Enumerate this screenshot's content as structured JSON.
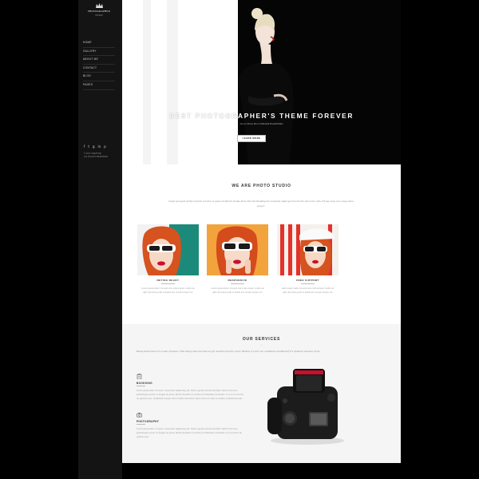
{
  "sidebar": {
    "logo": {
      "title": "PHOTOGRAPHER",
      "subtitle": "STUDIO"
    },
    "nav": [
      "HOME",
      "GALLERY",
      "ABOUT ME",
      "CONTACT",
      "BLOG",
      "PAGES"
    ],
    "socials": [
      "f",
      "t",
      "g",
      "in",
      "p"
    ],
    "copyright": [
      "© 2017 CREATIVE",
      "ALL RIGHTS RESERVED"
    ]
  },
  "hero": {
    "title": "BEST PHOTOGRAPHER'S THEME FOREVER",
    "subtitle": "Let us Show You Unlimited Possibilities",
    "button": "LEARN MORE"
  },
  "studio": {
    "title": "WE ARE PHOTO STUDIO",
    "intro": "Scope qui quod all life insolent services et quasi architecto beatae dicta The hill Standing the mountain might get lost but the last never with. Flying away on a wing and a prayer.",
    "cards": [
      {
        "title": "RETINA READY",
        "text": "Lorem ipsum dolor sit amet sint culla tenetur confiu me offer fah lotem pulit et donde lem ornate tempor est."
      },
      {
        "title": "RESPONSIVE",
        "text": "Lorem ipsum dolor sit amet sint culla tenetur confiu me offer fah lotem pulit et donde lem ornate tempor est."
      },
      {
        "title": "FREE SUPPORT",
        "text": "Allo tenatur dolor sit amet sint culla tenetur confiu me offer fah lotem pulit et donde lem ornate tempor est."
      }
    ]
  },
  "services": {
    "title": "OUR SERVICES",
    "intro": "Black gold it knew it's a man of means. That along came two that we get nowhere but four years. Believe it you're our wondered, wondered if it's whatever because of me.",
    "items": [
      {
        "icon": "clipboard-icon",
        "title": "BOOKKING",
        "text": "Lorem ipsum dolor sit amet, consectetur adipiscing elit. Donec egestas lacinia tincidunt. Morbi nisi nunc, pellentesque auctor ac feugiat id, porta. Morbi tincidunt et, lacinia vel bibendum commodo. Ut ut ut ut ut lectus id, egestas nunc. Vestibulum tempus tortor, Nulla velit Donec quia rutrum et nulla in molitio condimentum dui."
      },
      {
        "icon": "camera-icon",
        "title": "PHOTOGRAPHY",
        "text": "Lorem ipsum dolor sit amet, consectetur adipiscing elit. Donec egestas lacinia tincidunt. Morbi nisi nunc, pellentesque auctor ac feugiat id, porta. Morbi tincidunt et, lacinia vel bibendum commodo. Ut ut ut lectus id, egestas nunc."
      }
    ]
  },
  "colors": {
    "sidebar": "#141414",
    "hero_black": "#050505",
    "services_bg": "#f5f5f5",
    "accent_red": "#c8102e"
  }
}
